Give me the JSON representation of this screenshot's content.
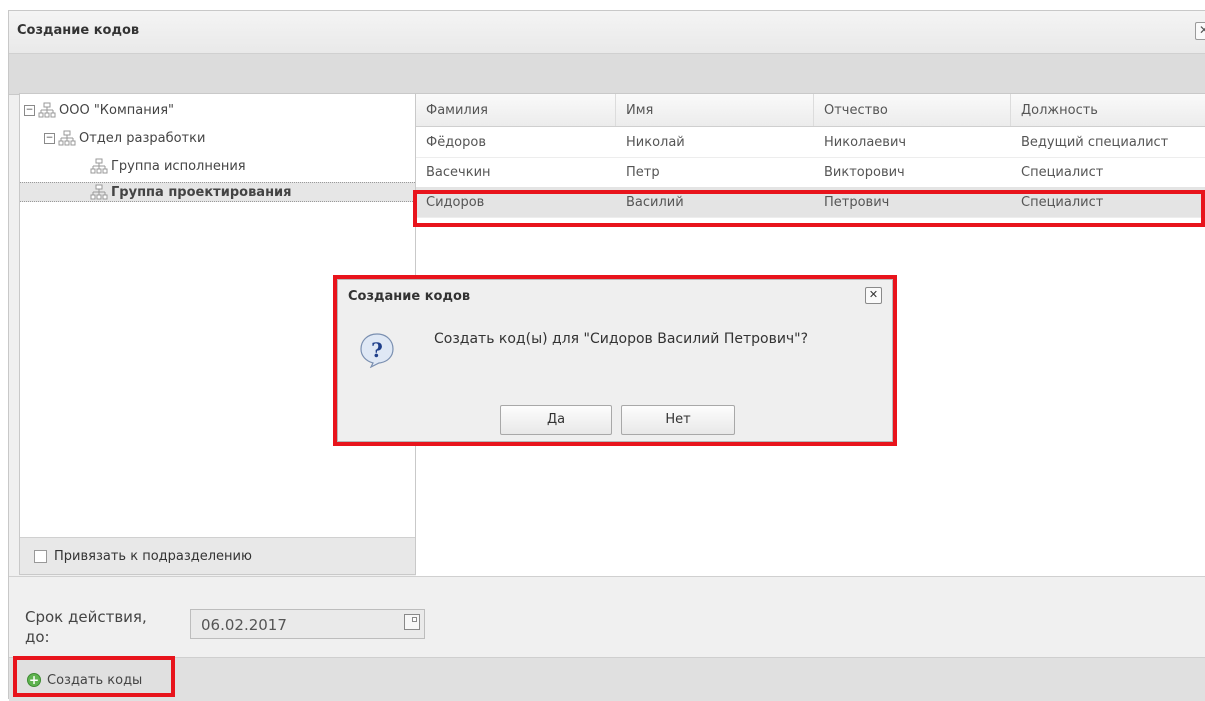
{
  "window": {
    "title": "Создание кодов",
    "close_glyph": "✕"
  },
  "tree": {
    "nodes": [
      {
        "label": "ООО \"Компания\"",
        "expander": "−",
        "icon": "org-structure-icon"
      },
      {
        "label": "Отдел разработки",
        "expander": "−",
        "icon": "org-structure-icon"
      },
      {
        "label": "Группа исполнения",
        "icon": "org-structure-icon"
      },
      {
        "label": "Группа проектирования",
        "icon": "org-structure-icon",
        "selected": true
      }
    ],
    "bind_checkbox_label": "Привязать к подразделению",
    "bind_checked": false
  },
  "grid": {
    "columns": [
      "Фамилия",
      "Имя",
      "Отчество",
      "Должность"
    ],
    "rows": [
      [
        "Фёдоров",
        "Николай",
        "Николаевич",
        "Ведущий специалист"
      ],
      [
        "Васечкин",
        "Петр",
        "Викторович",
        "Специалист"
      ],
      [
        "Сидоров",
        "Василий",
        "Петрович",
        "Специалист"
      ]
    ],
    "selected_row": 2
  },
  "form": {
    "expire_label": "Срок действия, до:",
    "expire_value": "06.02.2017",
    "calendar_icon": "calendar-icon"
  },
  "footer": {
    "create_button": "Создать коды",
    "create_icon": "add-circle-icon"
  },
  "dialog": {
    "title": "Создание кодов",
    "close_glyph": "✕",
    "icon": "question-icon",
    "message": "Создать код(ы) для \"Сидоров Василий Петрович\"?",
    "yes": "Да",
    "no": "Нет"
  },
  "colors": {
    "highlight": "#e8141c",
    "selection": "#e4e4e4",
    "accent_green": "#5fb34f",
    "question_blue": "#1f5fb8"
  }
}
